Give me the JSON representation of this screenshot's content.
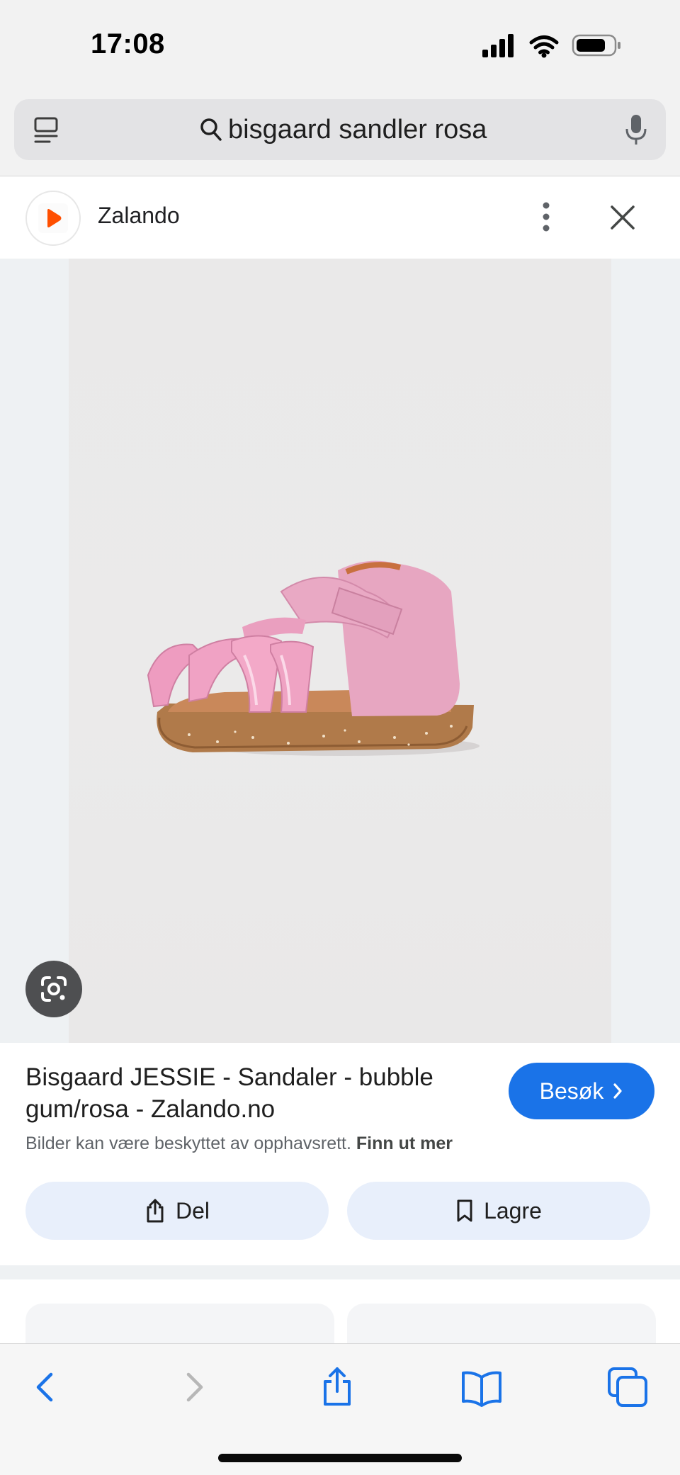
{
  "status_bar": {
    "time": "17:08",
    "icons": [
      "cellular-signal-icon",
      "wifi-icon",
      "battery-icon"
    ]
  },
  "search": {
    "query": "bisgaard sandler rosa",
    "left_icon": "tab-overview-icon",
    "search_icon": "search-icon",
    "right_icon": "microphone-icon"
  },
  "source": {
    "name": "Zalando",
    "logo": "zalando-logo",
    "menu_icon": "more-vert-icon",
    "close_icon": "close-icon"
  },
  "image": {
    "description_icon": "google-lens-icon",
    "background_color": "#eaeaea"
  },
  "result": {
    "title": "Bisgaard JESSIE - Sandaler - bubble gum/rosa - Zalando.no",
    "visit_label": "Besøk",
    "copyright_text": "Bilder kan være beskyttet av opphavsrett.",
    "copyright_link": "Finn ut mer",
    "share_label": "Del",
    "save_label": "Lagre"
  },
  "toolbar": {
    "items": [
      "back-icon",
      "forward-icon",
      "share-icon",
      "bookmarks-icon",
      "tabs-icon"
    ]
  },
  "colors": {
    "accent": "#1a73e8",
    "button_bg": "#e8effb",
    "zalando_orange": "#ff4f00",
    "sandal_pink": "#e9a9c4"
  }
}
